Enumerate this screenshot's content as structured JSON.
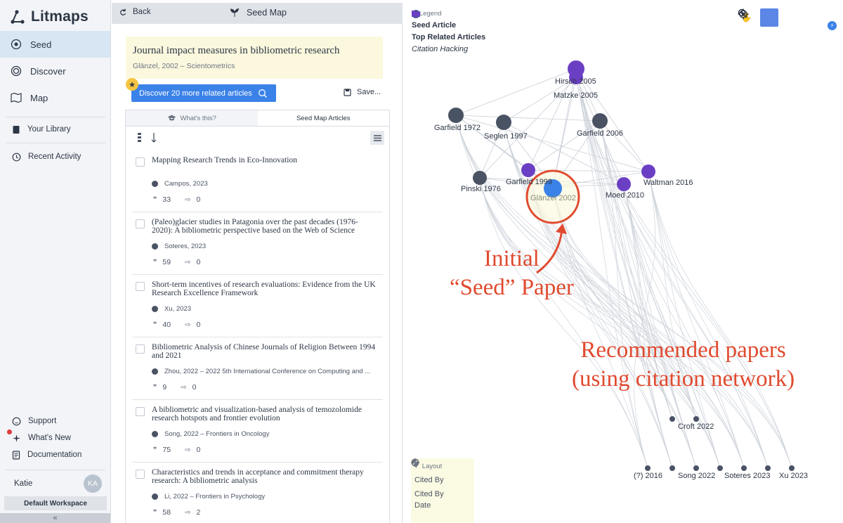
{
  "sidebar": {
    "brand": "Litmaps",
    "nav": [
      {
        "label": "Seed",
        "icon": "seed-icon"
      },
      {
        "label": "Discover",
        "icon": "discover-icon"
      },
      {
        "label": "Map",
        "icon": "map-icon"
      }
    ],
    "library": [
      {
        "label": "Your Library",
        "icon": "library-icon"
      },
      {
        "label": "Recent Activity",
        "icon": "history-icon"
      }
    ],
    "footer": [
      {
        "label": "Support",
        "icon": "support-icon"
      },
      {
        "label": "What's New",
        "icon": "sparkle-icon"
      },
      {
        "label": "Documentation",
        "icon": "docs-icon"
      }
    ],
    "user": {
      "name": "Katie",
      "initials": "KA"
    },
    "workspace": "Default Workspace",
    "collapse": "«"
  },
  "panel": {
    "back": "Back",
    "title": "Seed Map",
    "seed": {
      "title": "Journal impact measures in bibliometric research",
      "meta": "Glänzel, 2002 – Scientometrics"
    },
    "discover_button": "Discover 20 more related articles",
    "save_button": "Save...",
    "tabs": [
      "What's this?",
      "Seed Map Articles"
    ],
    "articles": [
      {
        "title": "Mapping Research Trends in Eco-Innovation",
        "meta": "Campos, 2023",
        "cited": "33",
        "refs": "0"
      },
      {
        "title": "(Paleo)glacier studies in Patagonia over the past decades (1976-2020): A bibliometric perspective based on the Web of Science",
        "meta": "Soteres, 2023",
        "cited": "59",
        "refs": "0"
      },
      {
        "title": "Short-term incentives of research evaluations: Evidence from the UK Research Excellence Framework",
        "meta": "Xu, 2023",
        "cited": "40",
        "refs": "0"
      },
      {
        "title": "Bibliometric Analysis of Chinese Journals of Religion Between 1994 and 2021",
        "meta": "Zhou, 2022 – 2022 5th International Conference on Computing and ...",
        "cited": "9",
        "refs": "0"
      },
      {
        "title": "A bibliometric and visualization-based analysis of temozolomide research hotspots and frontier evolution",
        "meta": "Song, 2022 – Frontiers in Oncology",
        "cited": "75",
        "refs": "0"
      },
      {
        "title": "Characteristics and trends in acceptance and commitment therapy research: A bibliometric analysis",
        "meta": "Li, 2022 – Frontiers in Psychology",
        "cited": "58",
        "refs": "2"
      }
    ]
  },
  "map": {
    "legend": {
      "header": "Legend",
      "items": [
        "Seed Article",
        "Top Related Articles",
        "Citation Hacking"
      ]
    },
    "layout": {
      "header": "Layout",
      "items": [
        "Cited By",
        "Cited By",
        "Date"
      ]
    },
    "nodes": [
      {
        "label": "Hirsch 2005"
      },
      {
        "label": "Matzke 2005"
      },
      {
        "label": "Garfield 1972"
      },
      {
        "label": "Seglen 1997"
      },
      {
        "label": "Garfield 2006"
      },
      {
        "label": "Pinski 1976"
      },
      {
        "label": "Garfield 1999"
      },
      {
        "label": "Glänzel 2002"
      },
      {
        "label": "Waltman 2016"
      },
      {
        "label": "Moed 2010"
      },
      {
        "label": "Croft 2022"
      },
      {
        "label": "(?) 2016"
      },
      {
        "label": "Song 2022"
      },
      {
        "label": "Soteres 2023"
      },
      {
        "label": "Xu 2023"
      }
    ],
    "annotations": {
      "seed": [
        "Initial",
        "“Seed” Paper"
      ],
      "recommended": [
        "Recommended papers",
        "(using citation network)"
      ]
    },
    "colors": {
      "accent": "#3b82e8",
      "purple": "#6b3fc4",
      "gray": "#4a5363",
      "annotation": "#e04a2f"
    }
  }
}
